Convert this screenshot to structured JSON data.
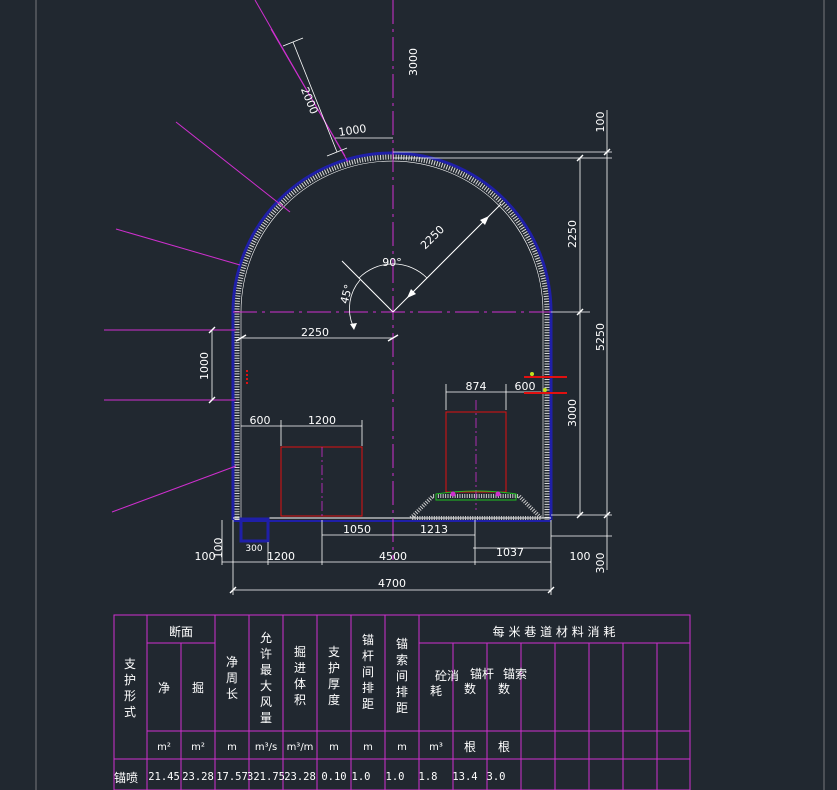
{
  "colors": {
    "background": "#212830",
    "outline": "#1f1fa8",
    "dim_line": "#ffffff",
    "center_line": "#cf2fcf",
    "rib_line": "#cf2fcf",
    "equipment": "#e01010",
    "track": "#20c020",
    "table_line": "#cf2fcf",
    "text": "#ffffff"
  },
  "dimensions": {
    "arch_thickness_slant": "2000",
    "arch_offset": "1000",
    "top_height": "3000",
    "top_clear": "100",
    "arch_rise": "2250",
    "total_height": "5250",
    "wall_height": "3000",
    "radius": "2250",
    "angle_90": "90°",
    "angle_45": "45°",
    "half_span": "2250",
    "left_step": "1000",
    "left_offset": "600",
    "left_equip_width": "1200",
    "left_equip_offset": "1050",
    "right_equip_width": "874",
    "right_clearance": "600",
    "right_equip_offset": "1213",
    "bottom_left_100": "100",
    "bottom_left_300": "300",
    "bottom_left_1200": "1200",
    "bottom_mid_4500": "4500",
    "bottom_right_1037": "1037",
    "bottom_right_100": "100",
    "bottom_right_300": "300",
    "overall_width": "4700"
  },
  "table": {
    "support_form_header": "支护形式",
    "section_header": "断面",
    "net_header": "净",
    "excavation_header": "掘",
    "net_perimeter_header": "净周长",
    "max_airflow_header": "允许最大风量",
    "excavation_volume_header": "掘进体积",
    "support_thickness_header": "支护厚度",
    "bolt_spacing_header": "锚杆间排距",
    "cable_spacing_header": "锚索间排距",
    "material_header": "每 米 巷 道 材 料 消 耗",
    "concrete_header": "砼消耗",
    "bolt_count_header": "锚杆数",
    "cable_count_header": "锚索数",
    "units": {
      "net": "m²",
      "excavation": "m²",
      "net_perimeter": "m",
      "max_airflow": "m³/s",
      "excavation_volume": "m³/m",
      "support_thickness": "m",
      "bolt_spacing": "m",
      "cable_spacing": "m",
      "concrete": "m³",
      "bolt_count": "根",
      "cable_count": "根"
    },
    "row": {
      "support_form": "锚喷",
      "net": "21.45",
      "excavation": "23.28",
      "net_perimeter": "17.57",
      "max_airflow": "321.75",
      "excavation_volume": "23.28",
      "support_thickness": "0.10",
      "bolt_spacing": "1.0",
      "cable_spacing": "1.0",
      "concrete": "1.8",
      "bolt_count": "13.4",
      "cable_count": "3.0"
    }
  }
}
